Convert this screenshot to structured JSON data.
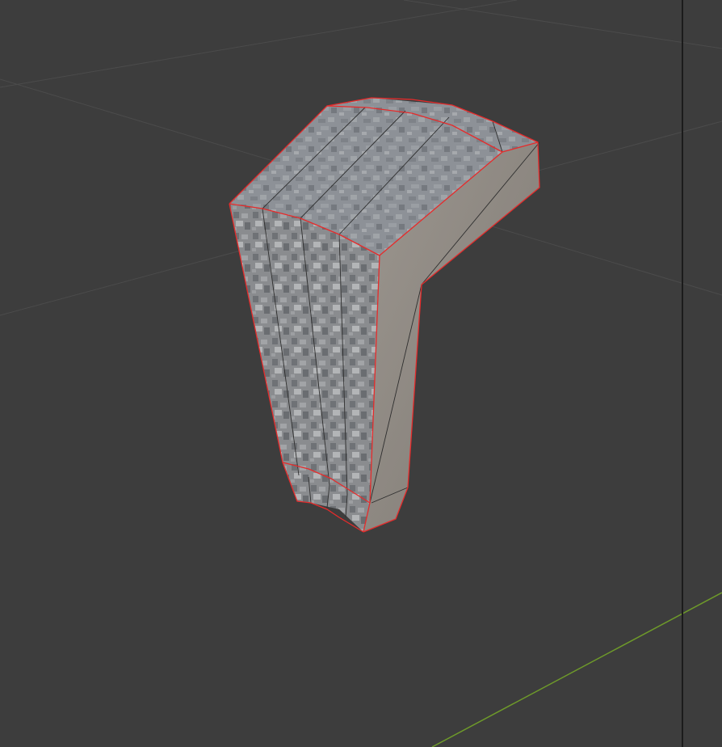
{
  "viewport": {
    "background_color": "#3d3d3d",
    "grid_color": "#4c4c4c",
    "x_axis_color": "#6e9a2a",
    "panel_divider_color": "#1b1b1b"
  },
  "mesh": {
    "shape": "bent-block",
    "base_color": "#8e9296",
    "side_color": "#8b8580",
    "selected_edge_color": "#e62b2b",
    "wire_color": "#2a2a2a"
  }
}
